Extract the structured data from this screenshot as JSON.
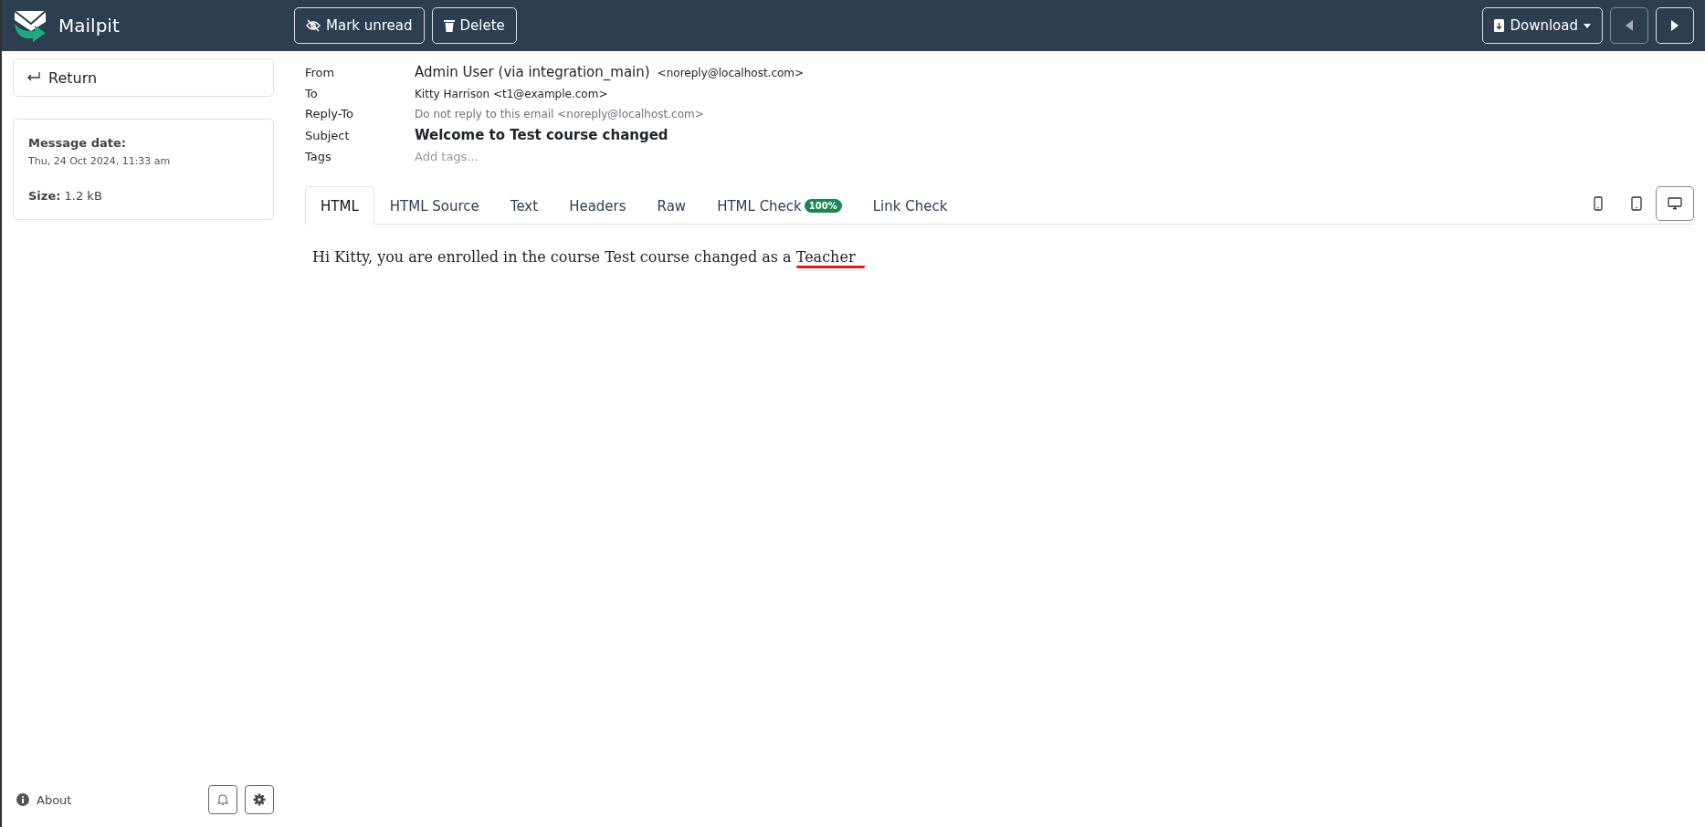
{
  "app": {
    "name": "Mailpit"
  },
  "toolbar": {
    "mark_unread": "Mark unread",
    "delete": "Delete",
    "download": "Download"
  },
  "sidebar": {
    "return": "Return",
    "date_label": "Message date:",
    "date": "Thu, 24 Oct 2024, 11:33 am",
    "size_label": "Size:",
    "size": "1.2 kB",
    "about": "About"
  },
  "headers": [
    {
      "label": "From",
      "kind": "sender",
      "value": "Admin User (via integration_main)",
      "extra": "<noreply@localhost.com>"
    },
    {
      "label": "To",
      "kind": "plain",
      "value": "Kitty Harrison <t1@example.com>"
    },
    {
      "label": "Reply-To",
      "kind": "muted",
      "value": "Do not reply to this email <noreply@localhost.com>"
    },
    {
      "label": "Subject",
      "kind": "subject",
      "value": "Welcome to Test course changed"
    },
    {
      "label": "Tags",
      "kind": "tags",
      "placeholder": "Add tags..."
    }
  ],
  "tabs": [
    {
      "label": "HTML",
      "selected": true
    },
    {
      "label": "HTML Source",
      "selected": false
    },
    {
      "label": "Text",
      "selected": false
    },
    {
      "label": "Headers",
      "selected": false
    },
    {
      "label": "Raw",
      "selected": false
    },
    {
      "label": "HTML Check",
      "selected": false,
      "badge": "100%"
    },
    {
      "label": "Link Check",
      "selected": false
    }
  ],
  "views": [
    {
      "kind": "phone",
      "selected": false
    },
    {
      "kind": "tablet",
      "selected": false
    },
    {
      "kind": "desktop",
      "selected": true
    }
  ],
  "body": {
    "text": "Hi Kitty, you are enrolled in the course Test course changed as a",
    "marked": "Teacher"
  }
}
